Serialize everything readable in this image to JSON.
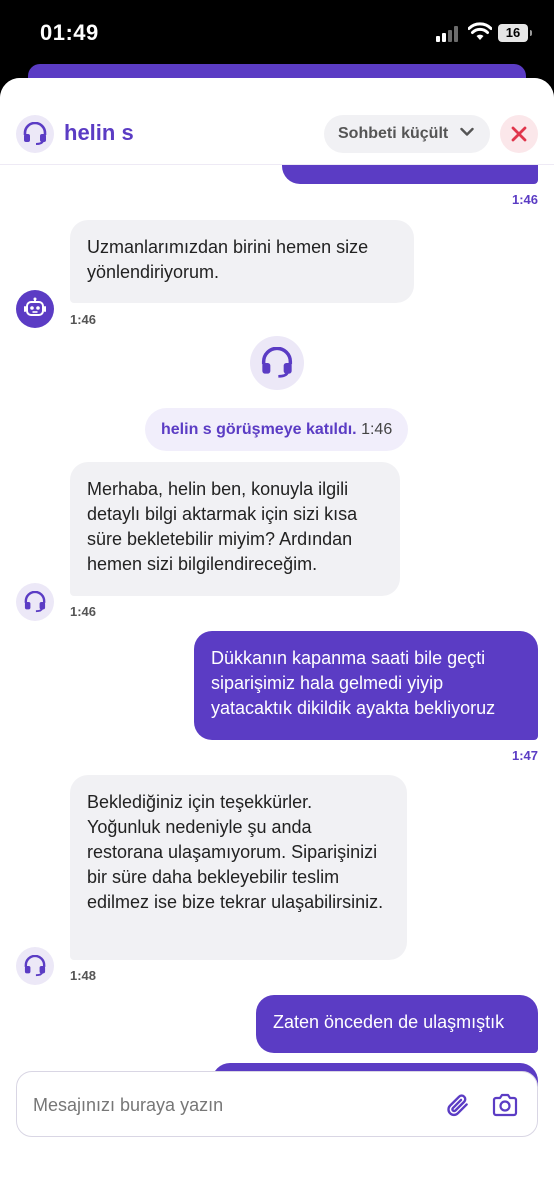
{
  "status_bar": {
    "time": "01:49",
    "battery": "16"
  },
  "header": {
    "agent_name": "helin s",
    "minimize_label": "Sohbeti küçült",
    "avatar_icon": "headset-icon",
    "close_icon": "close-icon"
  },
  "messages": [
    {
      "id": "partial-out",
      "side": "out",
      "text": "",
      "time": "1:46"
    },
    {
      "id": "m1",
      "side": "in",
      "text": "Uzmanlarımızdan birini hemen size yönlendiriyorum.",
      "time": "1:46",
      "avatar": "bot-icon"
    },
    {
      "id": "joined",
      "type": "system",
      "who": "helin s görüşmeye katıldı.",
      "time": "1:46"
    },
    {
      "id": "m2",
      "side": "in",
      "text": "Merhaba, helin ben, konuyla ilgili detaylı bilgi aktarmak için sizi kısa süre bekletebilir miyim? Ardından hemen sizi bilgilendireceğim.",
      "time": "1:46",
      "avatar": "headset-icon"
    },
    {
      "id": "m3",
      "side": "out",
      "text": "Dükkanın kapanma saati bile geçti siparişimiz hala gelmedi yiyip yatacaktık dikildik ayakta bekliyoruz",
      "time": "1:47"
    },
    {
      "id": "m4",
      "side": "in",
      "text": "Beklediğiniz için teşekkürler. Yoğunluk nedeniyle şu anda restorana ulaşamıyorum. Siparişinizi bir süre daha bekleyebilir teslim edilmez ise bize tekrar ulaşabilirsiniz.",
      "time": "1:48",
      "avatar": "headset-icon"
    },
    {
      "id": "m5",
      "side": "out",
      "text": "Zaten önceden de ulaşmıştık",
      "time": ""
    }
  ],
  "composer": {
    "placeholder": "Mesajınızı buraya yazın",
    "value": "",
    "attach_icon": "paperclip-icon",
    "camera_icon": "camera-icon"
  },
  "colors": {
    "brand": "#5b3cc4",
    "close": "#e0364c"
  }
}
